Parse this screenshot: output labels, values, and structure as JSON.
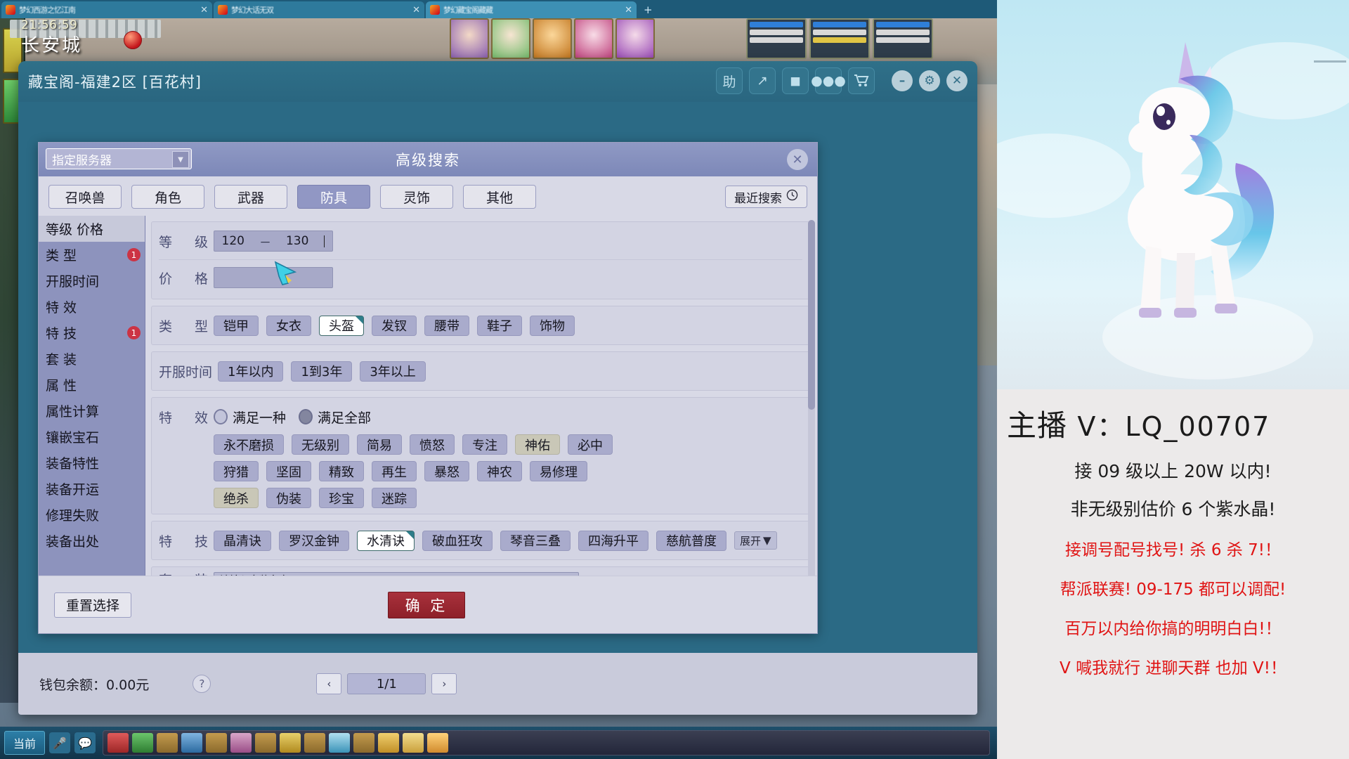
{
  "browser": {
    "tabs": [
      {
        "title": "梦幻西游之忆江南",
        "active": false
      },
      {
        "title": "梦幻大话无双",
        "active": false
      },
      {
        "title": "梦幻藏宝阁藏藏",
        "active": true
      }
    ],
    "new_tab_label": "+",
    "close_glyph": "✕"
  },
  "game_hud": {
    "time": "21:56:59",
    "city": "长安城"
  },
  "cbg_window": {
    "title": "藏宝阁-福建2区 [百花村]",
    "toolbar": [
      {
        "name": "help-button",
        "label": "助"
      },
      {
        "name": "share-button",
        "label": "↗"
      },
      {
        "name": "record-button",
        "label": "◼"
      },
      {
        "name": "chat-button",
        "label": "●●●"
      },
      {
        "name": "cart-button",
        "label": "🛒"
      }
    ],
    "window_controls": [
      {
        "name": "minimize-button",
        "label": "–"
      },
      {
        "name": "settings-button",
        "label": "⚙"
      },
      {
        "name": "close-button",
        "label": "✕"
      }
    ]
  },
  "advanced_search": {
    "header_title": "高级搜索",
    "server_select": {
      "value": "指定服务器",
      "arrow": "▼"
    },
    "close_label": "✕",
    "category_tabs": [
      {
        "label": "召唤兽",
        "active": false
      },
      {
        "label": "角色",
        "active": false
      },
      {
        "label": "武器",
        "active": false
      },
      {
        "label": "防具",
        "active": true
      },
      {
        "label": "灵饰",
        "active": false
      },
      {
        "label": "其他",
        "active": false
      }
    ],
    "recent_search": {
      "label": "最近搜索",
      "icon": "🕘"
    },
    "side_menu": [
      {
        "label": "等级 价格",
        "active": true,
        "badge": null,
        "spread": false
      },
      {
        "label": "类       型",
        "active": false,
        "badge": "1",
        "spread": false
      },
      {
        "label": "开服时间",
        "active": false,
        "badge": null,
        "spread": false
      },
      {
        "label": "特       效",
        "active": false,
        "badge": null,
        "spread": false
      },
      {
        "label": "特       技",
        "active": false,
        "badge": "1",
        "spread": false
      },
      {
        "label": "套       装",
        "active": false,
        "badge": null,
        "spread": false
      },
      {
        "label": "属       性",
        "active": false,
        "badge": null,
        "spread": false
      },
      {
        "label": "属性计算",
        "active": false,
        "badge": null,
        "spread": false
      },
      {
        "label": "镶嵌宝石",
        "active": false,
        "badge": null,
        "spread": false
      },
      {
        "label": "装备特性",
        "active": false,
        "badge": null,
        "spread": false
      },
      {
        "label": "装备开运",
        "active": false,
        "badge": null,
        "spread": false
      },
      {
        "label": "修理失败",
        "active": false,
        "badge": null,
        "spread": false
      },
      {
        "label": "装备出处",
        "active": false,
        "badge": null,
        "spread": false
      }
    ],
    "level_row": {
      "label_a": "等",
      "label_b": "级",
      "min": "120",
      "separator": "－",
      "max": "130"
    },
    "price_row": {
      "label_a": "价",
      "label_b": "格",
      "min": "",
      "separator": "",
      "max": ""
    },
    "type_row": {
      "label_a": "类",
      "label_b": "型",
      "options": [
        {
          "label": "铠甲",
          "state": "normal"
        },
        {
          "label": "女衣",
          "state": "normal"
        },
        {
          "label": "头盔",
          "state": "selected"
        },
        {
          "label": "发钗",
          "state": "normal"
        },
        {
          "label": "腰带",
          "state": "normal"
        },
        {
          "label": "鞋子",
          "state": "normal"
        },
        {
          "label": "饰物",
          "state": "normal"
        }
      ]
    },
    "server_age_row": {
      "label": "开服时间",
      "options": [
        {
          "label": "1年以内",
          "state": "normal"
        },
        {
          "label": "1到3年",
          "state": "normal"
        },
        {
          "label": "3年以上",
          "state": "normal"
        }
      ]
    },
    "special_effect_row": {
      "label_a": "特",
      "label_b": "效",
      "match_modes": [
        {
          "label": "满足一种",
          "selected": false
        },
        {
          "label": "满足全部",
          "selected": true
        }
      ],
      "rows": [
        [
          {
            "label": "永不磨损",
            "state": "normal"
          },
          {
            "label": "无级别",
            "state": "normal"
          },
          {
            "label": "简易",
            "state": "normal"
          },
          {
            "label": "愤怒",
            "state": "normal"
          },
          {
            "label": "专注",
            "state": "normal"
          },
          {
            "label": "神佑",
            "state": "tan"
          },
          {
            "label": "必中",
            "state": "normal"
          }
        ],
        [
          {
            "label": "狩猎",
            "state": "normal"
          },
          {
            "label": "坚固",
            "state": "normal"
          },
          {
            "label": "精致",
            "state": "normal"
          },
          {
            "label": "再生",
            "state": "normal"
          },
          {
            "label": "暴怒",
            "state": "normal"
          },
          {
            "label": "神农",
            "state": "normal"
          },
          {
            "label": "易修理",
            "state": "normal"
          }
        ],
        [
          {
            "label": "绝杀",
            "state": "tan"
          },
          {
            "label": "伪装",
            "state": "normal"
          },
          {
            "label": "珍宝",
            "state": "normal"
          },
          {
            "label": "迷踪",
            "state": "normal"
          }
        ]
      ]
    },
    "special_skill_row": {
      "label_a": "特",
      "label_b": "技",
      "options": [
        {
          "label": "晶清诀",
          "state": "normal"
        },
        {
          "label": "罗汉金钟",
          "state": "normal"
        },
        {
          "label": "水清诀",
          "state": "selected"
        },
        {
          "label": "破血狂攻",
          "state": "normal"
        },
        {
          "label": "琴音三叠",
          "state": "normal"
        },
        {
          "label": "四海升平",
          "state": "normal"
        },
        {
          "label": "慈航普度",
          "state": "normal"
        }
      ],
      "expand_label": "展开",
      "expand_arrow": "▼"
    },
    "footer": {
      "reset_label": "重置选择",
      "confirm_label": "确 定"
    }
  },
  "status_bar": {
    "wallet_label": "钱包余额：0.00元",
    "help_icon": "?",
    "prev_label": "‹",
    "page_value": "1/1",
    "next_label": "›"
  },
  "taskbar": {
    "start_label": "当前",
    "icons": [
      "🎤",
      "💬"
    ]
  },
  "stream_panel": {
    "title_prefix": "主播",
    "title_handle": "V：LQ_00707",
    "lines": [
      {
        "text": "接 09 级以上 20W 以内!",
        "color": "dark"
      },
      {
        "text": "非无级别估价 6 个紫水晶!",
        "color": "dark"
      },
      {
        "text": "接调号配号找号! 杀 6 杀 7!！",
        "color": "red"
      },
      {
        "text": "帮派联赛!  09-175 都可以调配!",
        "color": "red"
      },
      {
        "text": "百万以内给你搞的明明白白!！",
        "color": "red"
      },
      {
        "text": "V 喊我就行  进聊天群 也加 V!！",
        "color": "red"
      }
    ]
  },
  "colors": {
    "accent_purple": "#9197c4",
    "panel_bg": "#d8d9e6",
    "cbg_teal": "#2b6a85",
    "confirm_red": "#a8313c",
    "badge_red": "#cc3344",
    "promo_red": "#e01414"
  }
}
